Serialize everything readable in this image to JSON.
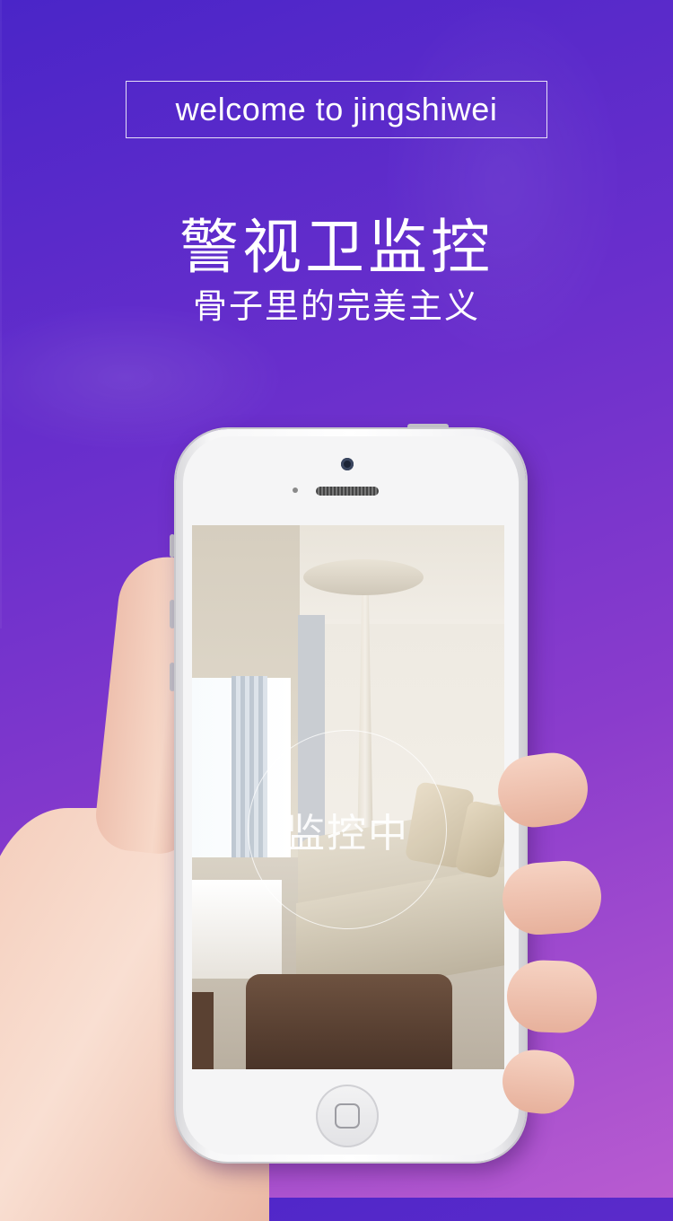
{
  "welcome": {
    "text": "welcome to jingshiwei"
  },
  "hero": {
    "title": "警视卫监控",
    "subtitle": "骨子里的完美主义"
  },
  "phone": {
    "status_text": "监控中",
    "home_icon": "home-button-icon"
  },
  "colors": {
    "bg_start": "#4a25c8",
    "bg_end": "#b85bd0",
    "text": "#ffffff"
  }
}
